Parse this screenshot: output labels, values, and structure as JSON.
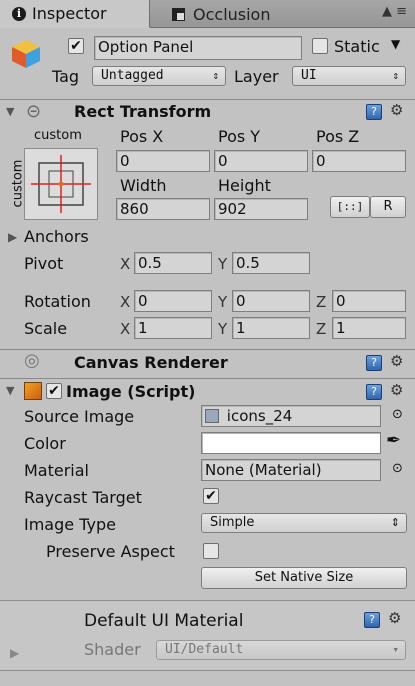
{
  "tabs": [
    {
      "label": "Inspector",
      "icon": "info-icon"
    },
    {
      "label": "Occlusion",
      "icon": "occlusion-icon"
    }
  ],
  "tab_tools": "▲ ≡",
  "object": {
    "name": "Option Panel",
    "active": true,
    "static_label": "Static",
    "static": false,
    "tag_label": "Tag",
    "tag_value": "Untagged",
    "layer_label": "Layer",
    "layer_value": "UI"
  },
  "rect_transform": {
    "title": "Rect Transform",
    "anchor_preset_h": "custom",
    "anchor_preset_v": "custom",
    "pos_x_label": "Pos X",
    "pos_y_label": "Pos Y",
    "pos_z_label": "Pos Z",
    "pos_x": "0",
    "pos_y": "0",
    "pos_z": "0",
    "width_label": "Width",
    "height_label": "Height",
    "width": "860",
    "height": "902",
    "raw_button": "R",
    "blueprint_button": "[::]",
    "anchors_label": "Anchors",
    "pivot_label": "Pivot",
    "pivot_x": "0.5",
    "pivot_y": "0.5",
    "rotation_label": "Rotation",
    "rot_x": "0",
    "rot_y": "0",
    "rot_z": "0",
    "scale_label": "Scale",
    "scale_x": "1",
    "scale_y": "1",
    "scale_z": "1",
    "axis_x": "X",
    "axis_y": "Y",
    "axis_z": "Z"
  },
  "canvas_renderer": {
    "title": "Canvas Renderer"
  },
  "image": {
    "title": "Image (Script)",
    "enabled": true,
    "source_image_label": "Source Image",
    "source_image_value": "icons_24",
    "color_label": "Color",
    "color_value": "#ffffff",
    "material_label": "Material",
    "material_value": "None (Material)",
    "raycast_label": "Raycast Target",
    "raycast": true,
    "image_type_label": "Image Type",
    "image_type_value": "Simple",
    "preserve_aspect_label": "Preserve Aspect",
    "preserve_aspect": false,
    "native_size_button": "Set Native Size"
  },
  "material_section": {
    "title": "Default UI Material",
    "shader_label": "Shader",
    "shader_value": "UI/Default"
  },
  "colors": {
    "panel_bg": "#c2c2c2",
    "help_blue": "#2f66b0",
    "anchor_red": "#e02020"
  }
}
